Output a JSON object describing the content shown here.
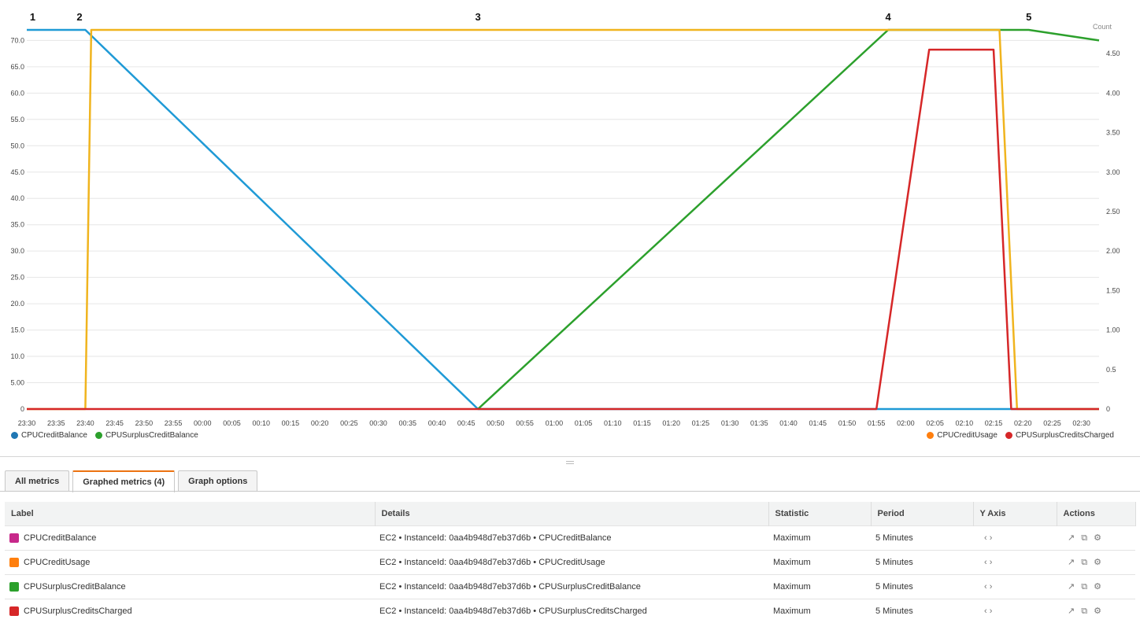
{
  "chart_data": {
    "type": "line",
    "x": [
      "23:30",
      "23:35",
      "23:40",
      "23:45",
      "23:50",
      "23:55",
      "00:00",
      "00:05",
      "00:10",
      "00:15",
      "00:20",
      "00:25",
      "00:30",
      "00:35",
      "00:40",
      "00:45",
      "00:50",
      "00:55",
      "01:00",
      "01:05",
      "01:10",
      "01:15",
      "01:20",
      "01:25",
      "01:30",
      "01:35",
      "01:40",
      "01:45",
      "01:50",
      "01:55",
      "02:00",
      "02:05",
      "02:10",
      "02:15",
      "02:20",
      "02:25",
      "02:30"
    ],
    "left_axis": {
      "ticks": [
        "0",
        "5.00",
        "10.0",
        "15.0",
        "20.0",
        "25.0",
        "30.0",
        "35.0",
        "40.0",
        "45.0",
        "50.0",
        "55.0",
        "60.0",
        "65.0",
        "70.0"
      ],
      "range": [
        0,
        72
      ]
    },
    "right_axis": {
      "label": "Count",
      "ticks": [
        "0",
        "0.5",
        "1.00",
        "1.50",
        "2.00",
        "2.50",
        "3.00",
        "3.50",
        "4.00",
        "4.50"
      ],
      "range": [
        0,
        4.8
      ]
    },
    "series": [
      {
        "name": "CPUCreditBalance",
        "axis": "left",
        "color": "#1f9ad6",
        "points": [
          [
            "23:30",
            72
          ],
          [
            "23:40",
            72
          ],
          [
            "00:47",
            0
          ],
          [
            "02:33",
            0
          ]
        ]
      },
      {
        "name": "CPUSurplusCreditBalance",
        "axis": "left",
        "color": "#2ca02c",
        "points": [
          [
            "00:47",
            0
          ],
          [
            "01:57",
            72
          ],
          [
            "02:21",
            72
          ],
          [
            "02:33",
            70
          ]
        ]
      },
      {
        "name": "CPUCreditUsage",
        "axis": "right",
        "color": "#f0b41e",
        "points": [
          [
            "23:30",
            0
          ],
          [
            "23:40",
            0
          ],
          [
            "23:41",
            4.8
          ],
          [
            "02:16",
            4.8
          ],
          [
            "02:19",
            0
          ],
          [
            "02:33",
            0
          ]
        ]
      },
      {
        "name": "CPUSurplusCreditsCharged",
        "axis": "right",
        "color": "#d62728",
        "points": [
          [
            "23:30",
            0
          ],
          [
            "01:55",
            0
          ],
          [
            "02:04",
            4.55
          ],
          [
            "02:15",
            4.55
          ],
          [
            "02:18",
            0
          ],
          [
            "02:33",
            0
          ]
        ]
      }
    ],
    "annotations": [
      {
        "text": "1",
        "x": "23:31"
      },
      {
        "text": "2",
        "x": "23:39"
      },
      {
        "text": "3",
        "x": "00:47"
      },
      {
        "text": "4",
        "x": "01:57"
      },
      {
        "text": "5",
        "x": "02:21"
      }
    ],
    "legend_left": [
      "CPUCreditBalance",
      "CPUSurplusCreditBalance"
    ],
    "legend_right": [
      "CPUCreditUsage",
      "CPUSurplusCreditsCharged"
    ],
    "legend_colors": {
      "CPUCreditBalance": "#1f77b4",
      "CPUSurplusCreditBalance": "#2ca02c",
      "CPUCreditUsage": "#ff7f0e",
      "CPUSurplusCreditsCharged": "#d62728"
    },
    "grid": true,
    "legend_placement": "bottom"
  },
  "tabs": [
    "All metrics",
    "Graphed metrics (4)",
    "Graph options"
  ],
  "table": {
    "headers": [
      "Label",
      "Details",
      "Statistic",
      "Period",
      "Y Axis",
      "Actions"
    ],
    "rows": [
      {
        "label": "CPUCreditBalance",
        "color": "#c7288a",
        "details": "EC2 • InstanceId: 0aa4b948d7eb37d6b • CPUCreditBalance",
        "statistic": "Maximum",
        "period": "5 Minutes"
      },
      {
        "label": "CPUCreditUsage",
        "color": "#ff7f0e",
        "details": "EC2 • InstanceId: 0aa4b948d7eb37d6b • CPUCreditUsage",
        "statistic": "Maximum",
        "period": "5 Minutes"
      },
      {
        "label": "CPUSurplusCreditBalance",
        "color": "#2ca02c",
        "details": "EC2 • InstanceId: 0aa4b948d7eb37d6b • CPUSurplusCreditBalance",
        "statistic": "Maximum",
        "period": "5 Minutes"
      },
      {
        "label": "CPUSurplusCreditsCharged",
        "color": "#d62728",
        "details": "EC2 • InstanceId: 0aa4b948d7eb37d6b • CPUSurplusCreditsCharged",
        "statistic": "Maximum",
        "period": "5 Minutes"
      }
    ]
  }
}
